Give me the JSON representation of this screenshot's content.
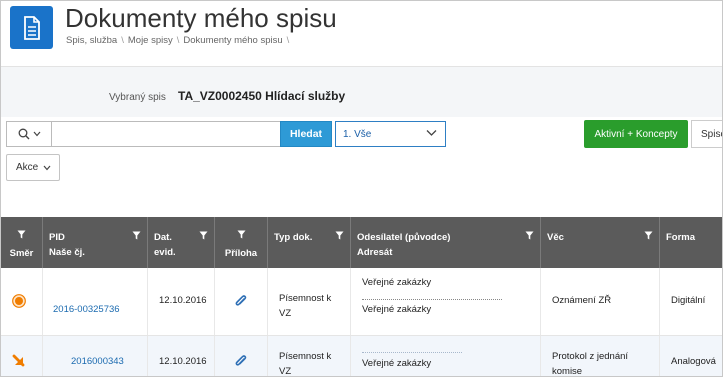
{
  "header": {
    "title": "Dokumenty mého spisu",
    "breadcrumbs": [
      "Spis, služba",
      "Moje spisy",
      "Dokumenty mého spisu"
    ],
    "separator": "\\"
  },
  "info": {
    "label": "Vybraný spis",
    "value": "TA_VZ0002450 Hlídací služby"
  },
  "toolbar": {
    "search_value": "",
    "search_button": "Hledat",
    "select_value": "1. Vše",
    "active_button": "Aktivní + Koncepty",
    "cut_button": "Spisc",
    "actions_button": "Akce"
  },
  "table": {
    "headers": {
      "smer": "Směr",
      "pid": "PID",
      "nase_cj": "Naše čj.",
      "dat": "Dat.",
      "evid": "evid.",
      "priloha": "Příloha",
      "typ": "Typ dok.",
      "odesilatel": "Odesílatel (původce)",
      "adresat": "Adresát",
      "vec": "Věc",
      "forma": "Forma"
    },
    "rows": [
      {
        "pid": "2016-00325736",
        "date": "12.10.2016",
        "typ_1": "Písemnost k",
        "typ_2": "VZ",
        "sender": "Veřejné zakázky",
        "recipient": "Veřejné zakázky",
        "vec": "Oznámení ZŘ",
        "forma": "Digitální"
      },
      {
        "pid": "2016000343",
        "date": "12.10.2016",
        "typ_1": "Písemnost k",
        "typ_2": "VZ",
        "recipient": "Veřejné zakázky",
        "vec_1": "Protokol z jednání",
        "vec_2": "komise",
        "forma": "Analogová"
      }
    ]
  },
  "colors": {
    "brand_blue": "#1a73c9",
    "search_button": "#2e9ad6",
    "green_button": "#2a9d2c",
    "header_row": "#5b5b5b",
    "link": "#1c6bb0",
    "incoming_icon": "#f07d00"
  },
  "icons": {
    "app": "document-icon",
    "search": "search-icon",
    "filter": "funnel-icon",
    "attachment": "paperclip-icon",
    "direction_in": "circle-dot-icon",
    "direction_out": "arrow-icon"
  }
}
